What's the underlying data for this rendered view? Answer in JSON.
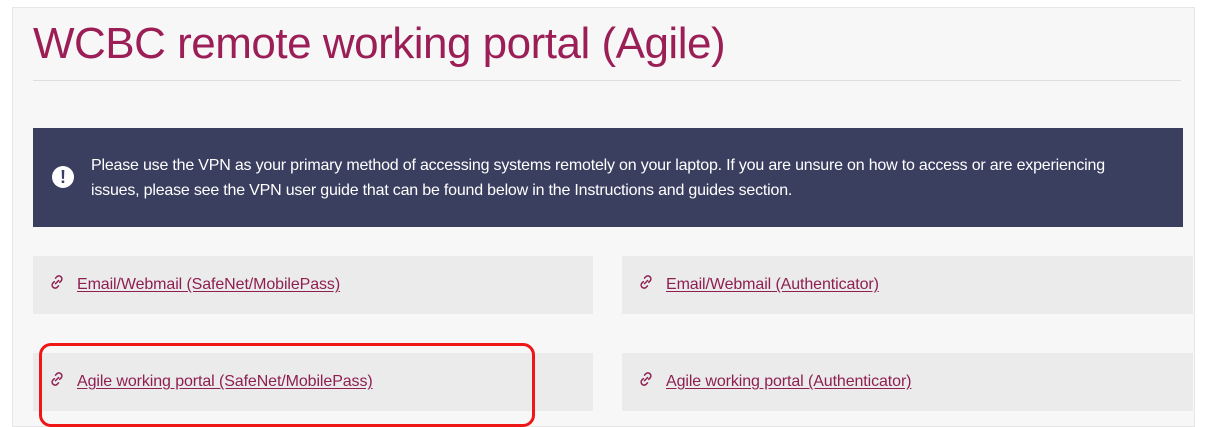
{
  "page": {
    "title": "WCBC remote working portal (Agile)"
  },
  "notice": {
    "icon": "exclamation-circle-icon",
    "text": "Please use the VPN as your primary method of accessing systems remotely on your laptop.  If you are unsure on how to access or are experiencing issues, please see the VPN user guide that can be found below in the Instructions and guides section."
  },
  "links": [
    {
      "label": "Email/Webmail (SafeNet/MobilePass)",
      "icon": "link-icon"
    },
    {
      "label": "Email/Webmail (Authenticator)",
      "icon": "link-icon"
    },
    {
      "label": "Agile working portal (SafeNet/MobilePass)",
      "icon": "link-icon"
    },
    {
      "label": "Agile working portal (Authenticator)",
      "icon": "link-icon"
    }
  ],
  "colors": {
    "title": "#9b1f56",
    "notice_background": "#3a3f60",
    "link": "#8e1f51",
    "card_background": "#ebebeb",
    "highlight": "#ef1616"
  }
}
